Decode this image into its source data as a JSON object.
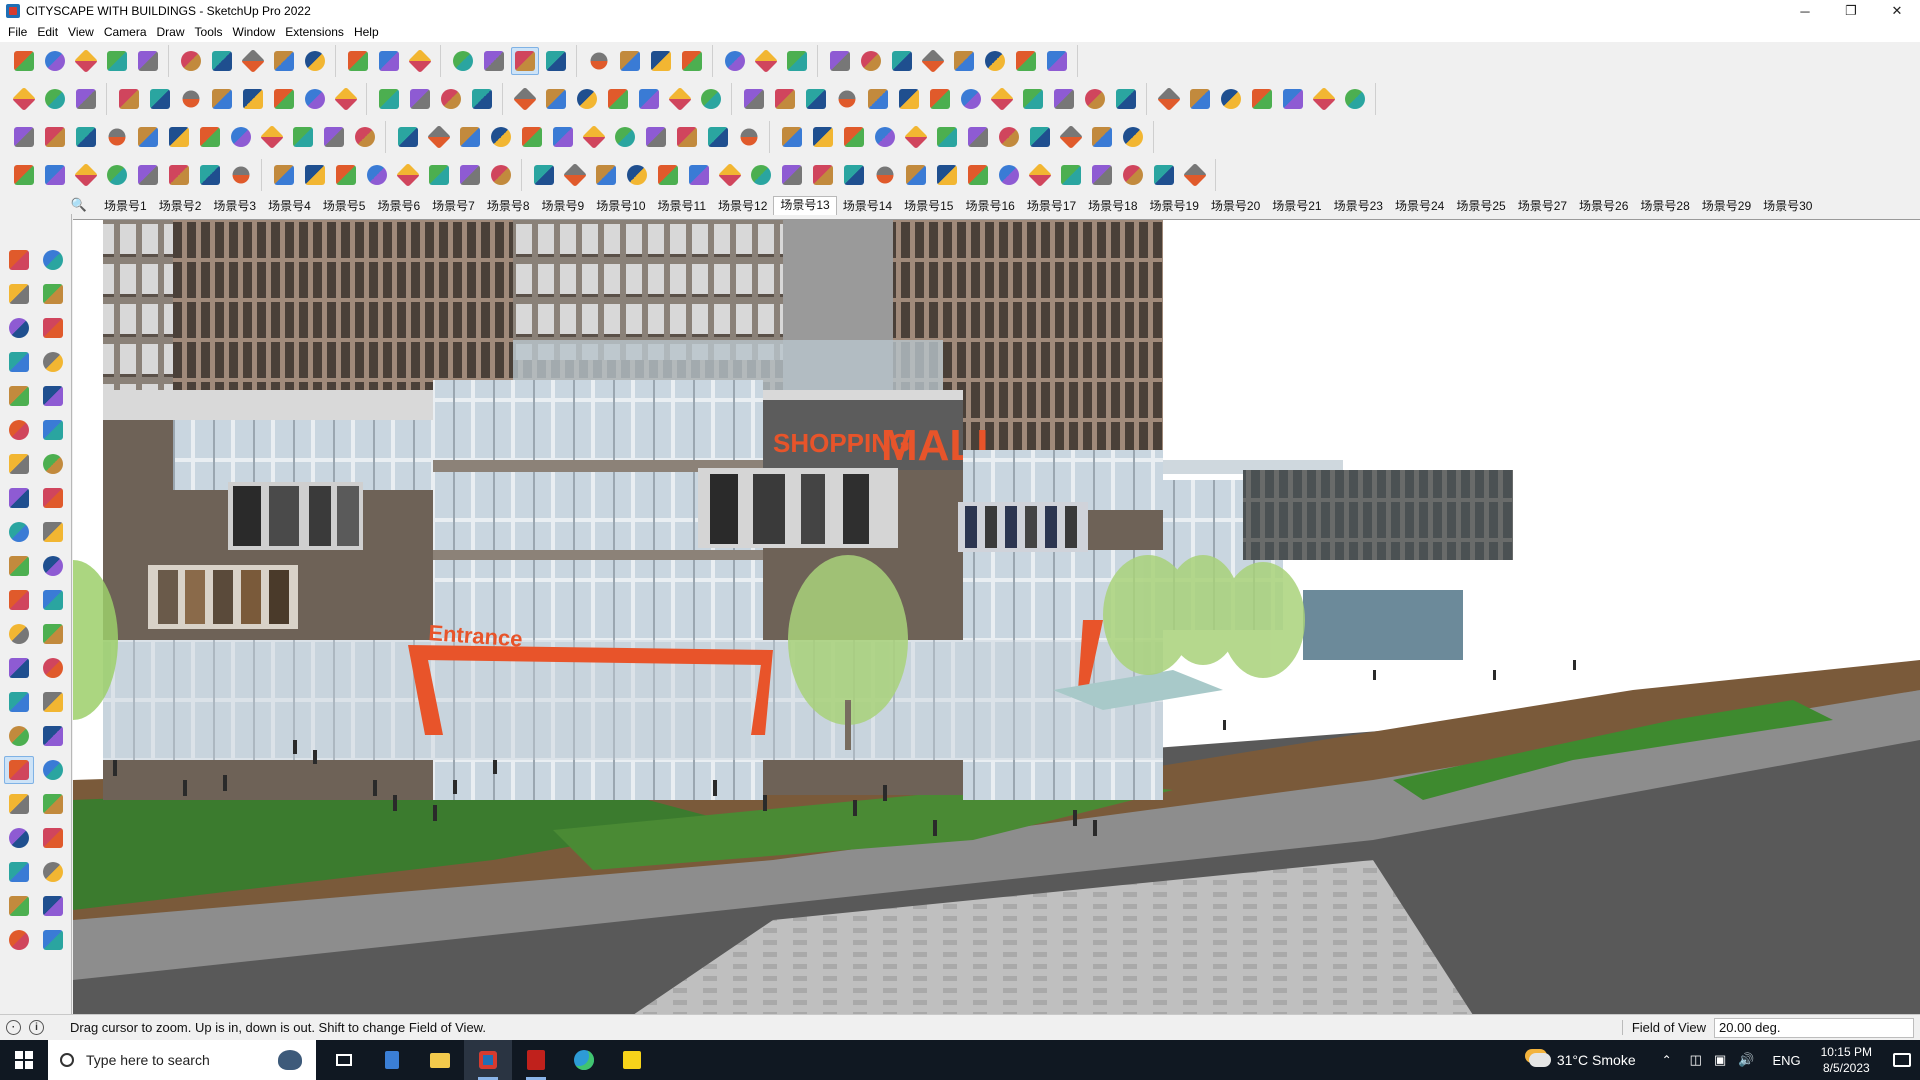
{
  "window": {
    "title": "CITYSCAPE WITH BUILDINGS - SketchUp Pro 2022",
    "controls": [
      "─",
      "❐",
      "✕"
    ]
  },
  "menu": [
    "File",
    "Edit",
    "View",
    "Camera",
    "Draw",
    "Tools",
    "Window",
    "Extensions",
    "Help"
  ],
  "scenes": {
    "active_index": 12,
    "tabs": [
      "场景号1",
      "场景号2",
      "场景号3",
      "场景号4",
      "场景号5",
      "场景号6",
      "场景号7",
      "场景号8",
      "场景号9",
      "场景号10",
      "场景号11",
      "场景号12",
      "场景号13",
      "场景号14",
      "场景号15",
      "场景号16",
      "场景号17",
      "场景号18",
      "场景号19",
      "场景号20",
      "场景号21",
      "场景号23",
      "场景号24",
      "场景号25",
      "场景号27",
      "场景号26",
      "场景号28",
      "场景号29",
      "场景号30"
    ]
  },
  "viewport": {
    "sign_shopping": "SHOPPING",
    "sign_mall": "MALL",
    "sign_entrance": "Entrance"
  },
  "status": {
    "message": "Drag cursor to zoom.  Up is in, down is out. Shift to change Field of View.",
    "measure_label": "Field of View",
    "measure_value": "20.00 deg."
  },
  "taskbar": {
    "search_placeholder": "Type here to search",
    "weather": "31°C  Smoke",
    "language": "ENG",
    "time": "10:15 PM",
    "date": "8/5/2023"
  },
  "colors": {
    "accent_orange": "#e8542a",
    "facade_brown": "#6e6257",
    "sky": "#ffffff",
    "taskbar": "#101822"
  }
}
